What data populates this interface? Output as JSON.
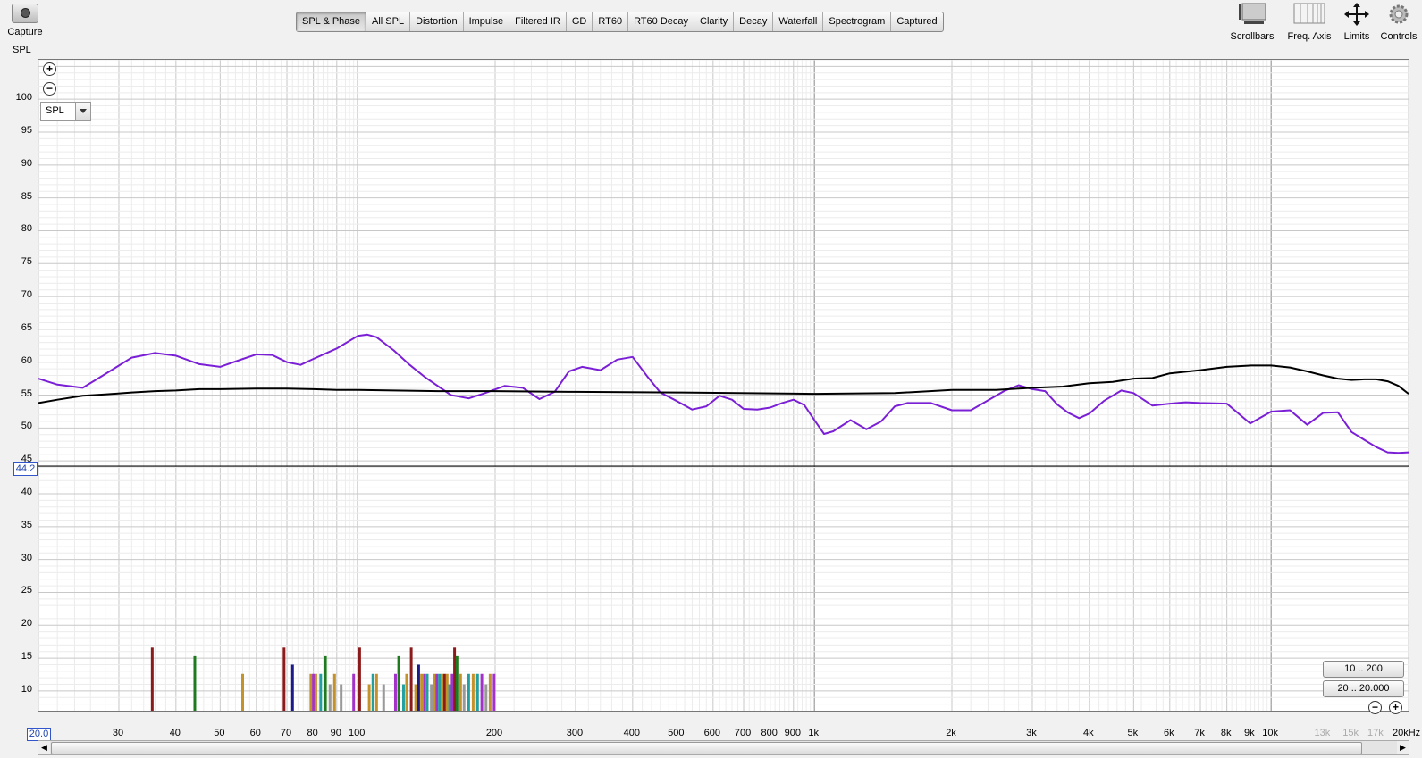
{
  "toolbar": {
    "capture_label": "Capture",
    "tabs": [
      "SPL & Phase",
      "All SPL",
      "Distortion",
      "Impulse",
      "Filtered IR",
      "GD",
      "RT60",
      "RT60 Decay",
      "Clarity",
      "Decay",
      "Waterfall",
      "Spectrogram",
      "Captured"
    ],
    "active_tab": "SPL & Phase",
    "right_tools": [
      "Scrollbars",
      "Freq. Axis",
      "Limits",
      "Controls"
    ]
  },
  "graph": {
    "y_axis_title": "SPL",
    "y_ticks": [
      "100",
      "95",
      "90",
      "85",
      "80",
      "75",
      "70",
      "65",
      "60",
      "55",
      "50",
      "45",
      "40",
      "35",
      "30",
      "25",
      "20",
      "15",
      "10"
    ],
    "x_ticks_major": [
      "30",
      "40",
      "50",
      "60",
      "70",
      "80",
      "90",
      "100",
      "200",
      "300",
      "400",
      "500",
      "600",
      "700",
      "800",
      "900",
      "1k",
      "2k",
      "3k",
      "4k",
      "5k",
      "6k",
      "7k",
      "8k",
      "9k",
      "10k"
    ],
    "x_ticks_dim": [
      "13k",
      "15k",
      "17k"
    ],
    "x_end_label": "20kHz",
    "cursor_y_value": "44.2",
    "cursor_x_value": "20.0",
    "select_value": "SPL",
    "range_buttons": [
      "10 .. 200",
      "20 .. 20.000"
    ],
    "colors": {
      "measurement": "#7a1fd6",
      "target": "#000000",
      "cursor": "#2244aa"
    }
  },
  "chart_data": {
    "type": "line",
    "xscale": "log",
    "xlim": [
      20,
      20000
    ],
    "ylim": [
      7,
      106
    ],
    "ylabel": "SPL",
    "cursor_level": 44.2,
    "series": [
      {
        "color": "#7a1fd6",
        "x": [
          20,
          22,
          25,
          28,
          32,
          36,
          40,
          45,
          50,
          55,
          60,
          65,
          70,
          75,
          80,
          90,
          100,
          105,
          110,
          120,
          130,
          140,
          160,
          175,
          190,
          210,
          230,
          250,
          270,
          290,
          310,
          340,
          370,
          400,
          430,
          460,
          500,
          540,
          580,
          620,
          660,
          700,
          750,
          800,
          850,
          900,
          950,
          1000,
          1050,
          1100,
          1200,
          1300,
          1400,
          1500,
          1600,
          1800,
          2000,
          2200,
          2400,
          2600,
          2800,
          3000,
          3200,
          3400,
          3600,
          3800,
          4000,
          4300,
          4700,
          5000,
          5500,
          6000,
          6500,
          7000,
          8000,
          9000,
          10000,
          11000,
          12000,
          13000,
          14000,
          15000,
          16000,
          17000,
          18000,
          19000,
          20000
        ],
        "y": [
          57.5,
          56.6,
          56.1,
          58.2,
          60.7,
          61.4,
          61,
          59.7,
          59.3,
          60.3,
          61.2,
          61.1,
          60,
          59.6,
          60.5,
          62.1,
          64,
          64.2,
          63.8,
          61.8,
          59.6,
          57.8,
          55,
          54.5,
          55.3,
          56.4,
          56.1,
          54.4,
          55.5,
          58.6,
          59.3,
          58.8,
          60.4,
          60.8,
          57.9,
          55.4,
          54.1,
          52.8,
          53.3,
          54.9,
          54.3,
          52.9,
          52.8,
          53.1,
          53.8,
          54.3,
          53.5,
          51.2,
          49.1,
          49.5,
          51.2,
          49.8,
          51,
          53.3,
          53.8,
          53.8,
          52.7,
          52.7,
          54.2,
          55.6,
          56.5,
          55.9,
          55.6,
          53.6,
          52.3,
          51.5,
          52.2,
          54.1,
          55.7,
          55.3,
          53.4,
          53.7,
          53.9,
          53.8,
          53.7,
          50.7,
          52.5,
          52.7,
          50.5,
          52.3,
          52.4,
          49.4,
          48.2,
          47.1,
          46.3,
          46.2,
          46.3
        ]
      },
      {
        "color": "#000000",
        "x": [
          20,
          22,
          25,
          28,
          32,
          36,
          40,
          45,
          50,
          60,
          70,
          80,
          90,
          100,
          120,
          150,
          200,
          300,
          500,
          1000,
          1500,
          2000,
          2500,
          3000,
          3500,
          4000,
          4500,
          5000,
          5500,
          6000,
          7000,
          8000,
          9000,
          10000,
          11000,
          12000,
          13000,
          14000,
          15000,
          16000,
          17000,
          18000,
          19000,
          20000
        ],
        "y": [
          53.8,
          54.3,
          54.9,
          55.1,
          55.4,
          55.6,
          55.7,
          55.9,
          55.9,
          56,
          56,
          55.9,
          55.8,
          55.8,
          55.7,
          55.6,
          55.6,
          55.5,
          55.4,
          55.2,
          55.3,
          55.8,
          55.8,
          56.1,
          56.3,
          56.8,
          57,
          57.5,
          57.6,
          58.3,
          58.8,
          59.3,
          59.5,
          59.5,
          59.2,
          58.6,
          58,
          57.5,
          57.3,
          57.4,
          57.4,
          57.1,
          56.4,
          55.2
        ]
      }
    ],
    "bars": [
      {
        "x": 35.5,
        "h": 16.6,
        "c": "#8b1a1a"
      },
      {
        "x": 44,
        "h": 15.3,
        "c": "#1f7a1f"
      },
      {
        "x": 56,
        "h": 12.6,
        "c": "#c4922a"
      },
      {
        "x": 69,
        "h": 16.6,
        "c": "#8b1a1a"
      },
      {
        "x": 72,
        "h": 14,
        "c": "#1a1a8b"
      },
      {
        "x": 79,
        "h": 12.6,
        "c": "#c4922a"
      },
      {
        "x": 80,
        "h": 12.6,
        "c": "#a333c8"
      },
      {
        "x": 81,
        "h": 12.6,
        "c": "#c4922a"
      },
      {
        "x": 83,
        "h": 12.6,
        "c": "#22a0a0"
      },
      {
        "x": 85,
        "h": 15.3,
        "c": "#1f7a1f"
      },
      {
        "x": 87,
        "h": 11,
        "c": "#999999"
      },
      {
        "x": 89,
        "h": 12.6,
        "c": "#c4922a"
      },
      {
        "x": 92,
        "h": 11,
        "c": "#999999"
      },
      {
        "x": 98,
        "h": 12.6,
        "c": "#a333c8"
      },
      {
        "x": 101,
        "h": 16.6,
        "c": "#8b1a1a"
      },
      {
        "x": 106,
        "h": 11,
        "c": "#c4922a"
      },
      {
        "x": 108,
        "h": 12.6,
        "c": "#22a0a0"
      },
      {
        "x": 110,
        "h": 12.6,
        "c": "#c4922a"
      },
      {
        "x": 114,
        "h": 11,
        "c": "#999999"
      },
      {
        "x": 121,
        "h": 12.6,
        "c": "#a333c8"
      },
      {
        "x": 123,
        "h": 15.3,
        "c": "#1f7a1f"
      },
      {
        "x": 126,
        "h": 11,
        "c": "#22a0a0"
      },
      {
        "x": 128,
        "h": 12.6,
        "c": "#c4922a"
      },
      {
        "x": 131,
        "h": 16.6,
        "c": "#8b1a1a"
      },
      {
        "x": 134,
        "h": 11,
        "c": "#c4922a"
      },
      {
        "x": 136,
        "h": 14,
        "c": "#1a1a8b"
      },
      {
        "x": 138,
        "h": 12.6,
        "c": "#c4922a"
      },
      {
        "x": 140,
        "h": 12.6,
        "c": "#a333c8"
      },
      {
        "x": 142,
        "h": 12.6,
        "c": "#22a0a0"
      },
      {
        "x": 145,
        "h": 11,
        "c": "#999999"
      },
      {
        "x": 147,
        "h": 12.6,
        "c": "#c4922a"
      },
      {
        "x": 149,
        "h": 12.6,
        "c": "#a333c8"
      },
      {
        "x": 151,
        "h": 12.6,
        "c": "#22a0a0"
      },
      {
        "x": 153,
        "h": 12.6,
        "c": "#c4922a"
      },
      {
        "x": 155,
        "h": 12.6,
        "c": "#8b1a1a"
      },
      {
        "x": 157,
        "h": 12.6,
        "c": "#c4922a"
      },
      {
        "x": 159,
        "h": 11,
        "c": "#22a0a0"
      },
      {
        "x": 161,
        "h": 12.6,
        "c": "#a333c8"
      },
      {
        "x": 163,
        "h": 16.6,
        "c": "#8b1a1a"
      },
      {
        "x": 165,
        "h": 15.3,
        "c": "#1f7a1f"
      },
      {
        "x": 168,
        "h": 12.6,
        "c": "#c4922a"
      },
      {
        "x": 171,
        "h": 11,
        "c": "#999999"
      },
      {
        "x": 175,
        "h": 12.6,
        "c": "#22a0a0"
      },
      {
        "x": 179,
        "h": 12.6,
        "c": "#c4922a"
      },
      {
        "x": 183,
        "h": 12.6,
        "c": "#22a0a0"
      },
      {
        "x": 187,
        "h": 12.6,
        "c": "#a333c8"
      },
      {
        "x": 191,
        "h": 11,
        "c": "#999999"
      },
      {
        "x": 195,
        "h": 12.6,
        "c": "#c4922a"
      },
      {
        "x": 199,
        "h": 12.6,
        "c": "#a333c8"
      }
    ]
  }
}
